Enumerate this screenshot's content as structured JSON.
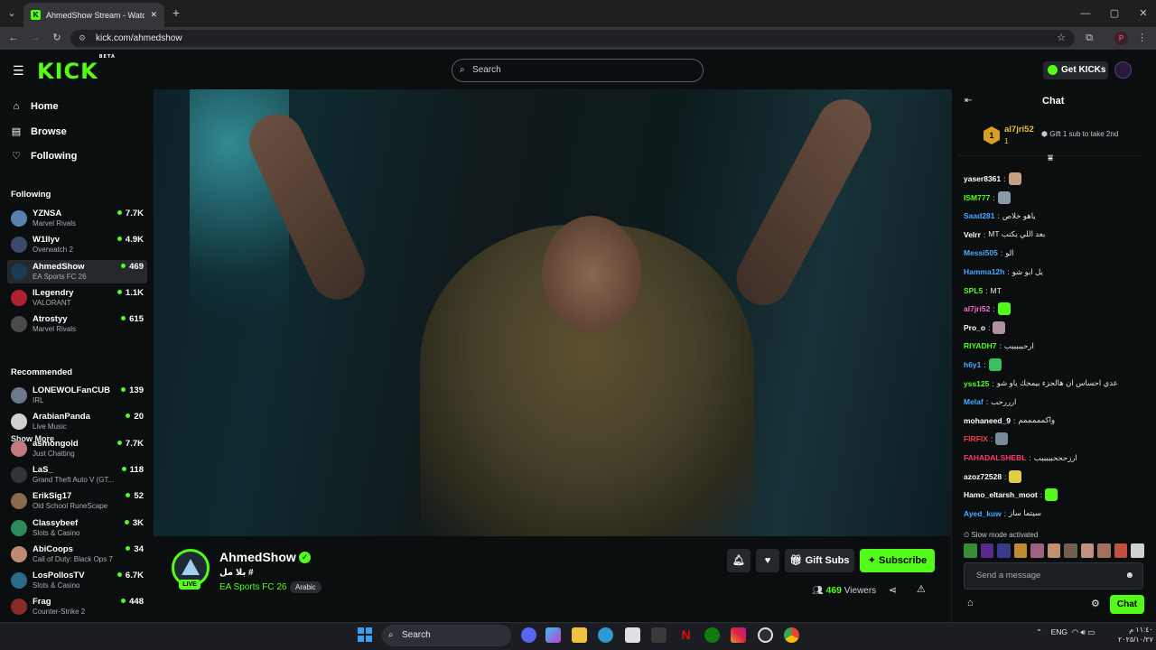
{
  "browser": {
    "tab_title": "AhmedShow Stream - Watch Li...",
    "tab_close": "✕",
    "new_tab": "+",
    "url": "kick.com/ahmedshow",
    "window_controls": [
      "—",
      "▢",
      "✕"
    ],
    "profile_initial": "P"
  },
  "header": {
    "logo": "KICK",
    "logo_sup": "BETA",
    "search_placeholder": "Search",
    "get_kicks": "Get KICKs"
  },
  "sidebar": {
    "nav": [
      {
        "label": "Home",
        "icon": "home-icon"
      },
      {
        "label": "Browse",
        "icon": "browse-icon"
      },
      {
        "label": "Following",
        "icon": "heart-icon"
      }
    ],
    "following_heading": "Following",
    "following": [
      {
        "name": "YZNSA",
        "category": "Marvel Rivals",
        "viewers": "7.7K",
        "color": "#5a7fb0"
      },
      {
        "name": "W1llyv",
        "category": "Overwatch 2",
        "viewers": "4.9K",
        "color": "#3a4a6a"
      },
      {
        "name": "AhmedShow",
        "category": "EA Sports FC 26",
        "viewers": "469",
        "color": "#1d3a55"
      },
      {
        "name": "ILegendry",
        "category": "VALORANT",
        "viewers": "1.1K",
        "color": "#b02030"
      },
      {
        "name": "Atrostyy",
        "category": "Marvel Rivals",
        "viewers": "615",
        "color": "#4a4a4a"
      }
    ],
    "show_more": "Show More",
    "recommended_heading": "Recommended",
    "recommended": [
      {
        "name": "LONEWOLFanCUB",
        "category": "IRL",
        "viewers": "139",
        "color": "#6a7a8a"
      },
      {
        "name": "ArabianPanda",
        "category": "Live Music",
        "viewers": "20",
        "color": "#d0d0d0"
      },
      {
        "name": "asmongold",
        "category": "Just Chatting",
        "viewers": "7.7K",
        "color": "#c07a80"
      },
      {
        "name": "LaS_",
        "category": "Grand Theft Auto V (GT...",
        "viewers": "118",
        "color": "#30343a"
      },
      {
        "name": "ErikSig17",
        "category": "Old School RuneScape",
        "viewers": "52",
        "color": "#8a6a4a"
      },
      {
        "name": "Classybeef",
        "category": "Slots & Casino",
        "viewers": "3K",
        "color": "#2a8a5a"
      },
      {
        "name": "AbiCoops",
        "category": "Call of Duty: Black Ops 7",
        "viewers": "34",
        "color": "#c08a70"
      },
      {
        "name": "LosPollosTV",
        "category": "Slots & Casino",
        "viewers": "6.7K",
        "color": "#2a6a8a"
      },
      {
        "name": "Frag",
        "category": "Counter-Strike 2",
        "viewers": "448",
        "color": "#8a2a2a"
      }
    ]
  },
  "stream": {
    "name": "AhmedShow",
    "live_badge": "LIVE",
    "title": "بلا مل #",
    "category": "EA Sports FC 26",
    "language": "Arabic",
    "gift_subs": "Gift Subs",
    "subscribe": "Subscribe",
    "viewer_count": "469",
    "viewers_label": "Viewers"
  },
  "chat": {
    "title": "Chat",
    "pinned_user": "al7jri52",
    "pinned_rank": "1",
    "pinned_count": "1",
    "gift_hint": "Gift 1 sub to take 2nd",
    "messages": [
      {
        "user": "yaser8361",
        "color": "#ffffff",
        "text": "",
        "emote": "#c8a080"
      },
      {
        "user": "ISM777",
        "color": "#53fc18",
        "text": "",
        "emote": "#8a9aaa"
      },
      {
        "user": "Saad281",
        "color": "#4aa8ff",
        "text": "ياهو خلاص",
        "emote": ""
      },
      {
        "user": "Velrr",
        "color": "#ffffff",
        "text": "MT بعد اللي يكتب",
        "emote": ""
      },
      {
        "user": "Messi505",
        "color": "#4aa8ff",
        "text": "الو",
        "emote": ""
      },
      {
        "user": "Hamma12h",
        "color": "#4aa8ff",
        "text": "يل ابو شو",
        "emote": ""
      },
      {
        "user": "SPL5",
        "color": "#53fc18",
        "text": "MT",
        "emote": ""
      },
      {
        "user": "al7jri52",
        "color": "#ff6ad5",
        "text": "",
        "emote": "#53fc18"
      },
      {
        "user": "Pro_o",
        "color": "#ffffff",
        "text": "",
        "emote": "#b090a0"
      },
      {
        "user": "RIYADH7",
        "color": "#53fc18",
        "text": "ارحبببببب",
        "emote": ""
      },
      {
        "user": "h6y1",
        "color": "#4aa8ff",
        "text": "",
        "emote": "#3ac060"
      },
      {
        "user": "yss125",
        "color": "#53fc18",
        "text": "عدي احساس ان هالجزء بيمجك ياو شو",
        "emote": ""
      },
      {
        "user": "Melaf",
        "color": "#4aa8ff",
        "text": "ارررحب",
        "emote": ""
      },
      {
        "user": "mohaneed_9",
        "color": "#ffffff",
        "text": "واكمممممم",
        "emote": ""
      },
      {
        "user": "FIRFIX",
        "color": "#ff3a3a",
        "text": "",
        "emote": "#7a8a9a"
      },
      {
        "user": "FAHADALSHEBL",
        "color": "#ff3a6a",
        "text": "ارزحححبببببب",
        "emote": ""
      },
      {
        "user": "azoz72528",
        "color": "#ffffff",
        "text": "",
        "emote": "#e0d040"
      },
      {
        "user": "Hamo_eltarsh_moot",
        "color": "#ffffff",
        "text": "",
        "emote": "#53fc18"
      },
      {
        "user": "Ayed_kuw",
        "color": "#4aa8ff",
        "text": "سيتما ساز",
        "emote": ""
      }
    ],
    "slow_mode": "Slow mode activated",
    "message_placeholder": "Send a message",
    "chat_button": "Chat"
  },
  "taskbar": {
    "search": "Search",
    "lang": "ENG",
    "time": "١١:٤٠ م",
    "date": "٢٠٢٥/١٠/٢٧"
  }
}
